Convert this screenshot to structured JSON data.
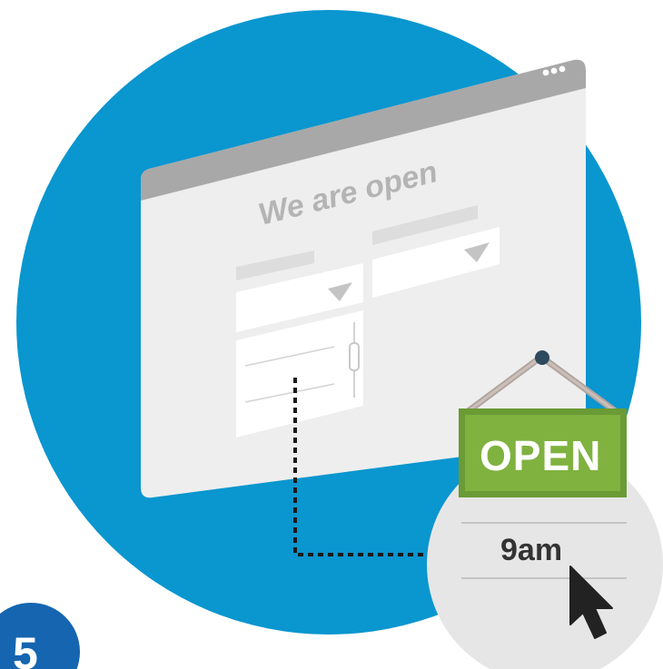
{
  "step": {
    "number": "5"
  },
  "window": {
    "title": "We are open"
  },
  "sign": {
    "label": "OPEN"
  },
  "dropdown_list": {
    "selected": "9am"
  },
  "icons": {
    "cursor": "arrow-cursor-icon",
    "menu": "ellipsis-icon",
    "dropdown": "triangle-down-icon",
    "hook": "nail-icon"
  },
  "colors": {
    "circle": "#0a96cf",
    "badge": "#1565b0",
    "sign_green": "#7fb23f",
    "window": "#eeeeee",
    "window_bar": "#a8a8a8"
  }
}
